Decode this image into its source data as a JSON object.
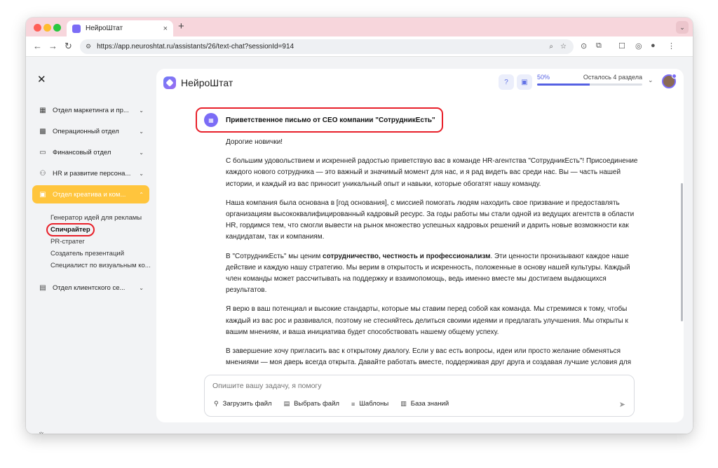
{
  "browser": {
    "tab_title": "НейроШтат",
    "tab_close": "×",
    "new_tab": "+",
    "url": "https://app.neuroshtat.ru/assistants/26/text-chat?sessionId=914"
  },
  "icons": {
    "back": "←",
    "forward": "→",
    "reload": "↻",
    "tune": "⚙",
    "zoom": "⌕",
    "star": "☆",
    "ext1": "⊙",
    "ext2": "⧉",
    "ext3": "☐",
    "ext4": "◎",
    "profile": "●",
    "more": "⋮",
    "close": "✕",
    "sun": "☼",
    "chevron": "⌄",
    "chevron_up": "⌃",
    "help": "?",
    "cap": "▣",
    "bot": "▦",
    "clip": "⚲",
    "folder": "▤",
    "templates": "≡",
    "book": "▥",
    "send": "➤",
    "dept_marketing": "▦",
    "dept_ops": "▩",
    "dept_finance": "▭",
    "dept_hr": "⚇",
    "dept_creative": "▣",
    "dept_clients": "▤"
  },
  "app": {
    "name": "НейроШтат",
    "progress": {
      "percent_label": "50%",
      "value": 0.5,
      "remaining_label": "Осталось 4 раздела"
    }
  },
  "sidebar": {
    "departments": [
      {
        "label": "Отдел маркетинга и пр..."
      },
      {
        "label": "Операционный отдел"
      },
      {
        "label": "Финансовый отдел"
      },
      {
        "label": "HR и развитие персона..."
      },
      {
        "label": "Отдел креатива и ком..."
      },
      {
        "label": "Отдел клиентского се..."
      }
    ],
    "creative_subitems": [
      {
        "label": "Генератор идей для рекламы"
      },
      {
        "label": "Спичрайтер"
      },
      {
        "label": "PR-стратег"
      },
      {
        "label": "Создатель презентаций"
      },
      {
        "label": "Специалист по визуальным ко..."
      }
    ]
  },
  "chat": {
    "title": "Приветственное письмо от CEO компании \"СотрудникЕсть\"",
    "greeting": "Дорогие новички!",
    "p1": "С большим удовольствием и искренней радостью приветствую вас в команде HR-агентства \"СотрудникЕсть\"! Присоединение каждого нового сотрудника — это важный и значимый момент для нас, и я рад видеть вас среди нас. Вы — часть нашей истории, и каждый из вас приносит уникальный опыт и навыки, которые обогатят нашу команду.",
    "p2": "Наша компания была основана в [год основания], с миссией помогать людям находить свое призвание и предоставлять организациям высококвалифицированный кадровый ресурс. За годы работы мы стали одной из ведущих агентств в области HR, гордимся тем, что смогли вывести на рынок множество успешных кадровых решений и дарить новые возможности как кандидатам, так и компаниям.",
    "p3_before": "В \"СотрудникЕсть\" мы ценим ",
    "p3_bold": "сотрудничество, честность и профессионализм",
    "p3_after": ". Эти ценности пронизывают каждое наше действие и каждую нашу стратегию. Мы верим в открытость и искренность, положенные в основу нашей культуры. Каждый член команды может рассчитывать на поддержку и взаимопомощь, ведь именно вместе мы достигаем выдающихся результатов.",
    "p4": "Я верю в ваш потенциал и высокие стандарты, которые мы ставим перед собой как команда. Мы стремимся к тому, чтобы каждый из вас рос и развивался, поэтому не стесняйтесь делиться своими идеями и предлагать улучшения. Мы открыты к вашим мнениям, и ваша инициатива будет способствовать нашему общему успеху.",
    "p5": "В завершение хочу пригласить вас к открытому диалогу. Если у вас есть вопросы, идеи или просто желание обменяться мнениями — моя дверь всегда открыта. Давайте работать вместе, поддерживая друг друга и создавая лучшие условия для роста и успеха."
  },
  "composer": {
    "placeholder": "Опишите вашу задачу, я помогу",
    "upload_label": "Загрузить файл",
    "choose_label": "Выбрать файл",
    "templates_label": "Шаблоны",
    "knowledge_label": "База знаний"
  }
}
